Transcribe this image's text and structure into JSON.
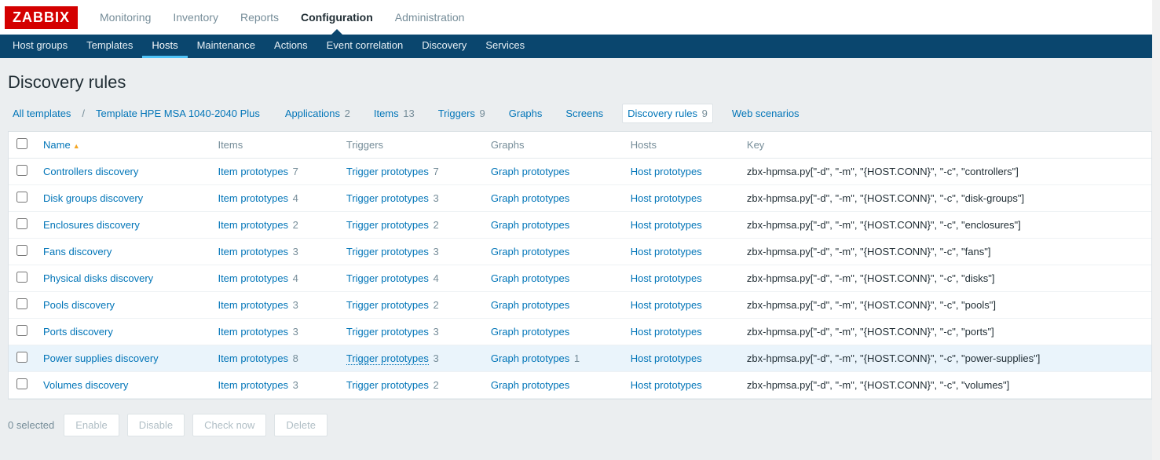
{
  "logo": "ZABBIX",
  "topnav": {
    "items": [
      "Monitoring",
      "Inventory",
      "Reports",
      "Configuration",
      "Administration"
    ],
    "active_index": 3
  },
  "subnav": {
    "items": [
      "Host groups",
      "Templates",
      "Hosts",
      "Maintenance",
      "Actions",
      "Event correlation",
      "Discovery",
      "Services"
    ],
    "active_index": 2
  },
  "page_title": "Discovery rules",
  "crumbs": {
    "all_templates": "All templates",
    "template_name": "Template HPE MSA 1040-2040 Plus",
    "tabs": [
      {
        "label": "Applications",
        "count": 2
      },
      {
        "label": "Items",
        "count": 13
      },
      {
        "label": "Triggers",
        "count": 9
      },
      {
        "label": "Graphs",
        "count": null
      },
      {
        "label": "Screens",
        "count": null
      },
      {
        "label": "Discovery rules",
        "count": 9
      },
      {
        "label": "Web scenarios",
        "count": null
      }
    ],
    "active_tab_index": 5
  },
  "table": {
    "headers": {
      "name": "Name",
      "items": "Items",
      "triggers": "Triggers",
      "graphs": "Graphs",
      "hosts": "Hosts",
      "key": "Key"
    },
    "labels": {
      "item_prototypes": "Item prototypes",
      "trigger_prototypes": "Trigger prototypes",
      "graph_prototypes": "Graph prototypes",
      "host_prototypes": "Host prototypes"
    },
    "rows": [
      {
        "name": "Controllers discovery",
        "items": 7,
        "triggers": 7,
        "graphs": null,
        "key": "zbx-hpmsa.py[\"-d\", \"-m\", \"{HOST.CONN}\", \"-c\", \"controllers\"]"
      },
      {
        "name": "Disk groups discovery",
        "items": 4,
        "triggers": 3,
        "graphs": null,
        "key": "zbx-hpmsa.py[\"-d\", \"-m\", \"{HOST.CONN}\", \"-c\", \"disk-groups\"]"
      },
      {
        "name": "Enclosures discovery",
        "items": 2,
        "triggers": 2,
        "graphs": null,
        "key": "zbx-hpmsa.py[\"-d\", \"-m\", \"{HOST.CONN}\", \"-c\", \"enclosures\"]"
      },
      {
        "name": "Fans discovery",
        "items": 3,
        "triggers": 3,
        "graphs": null,
        "key": "zbx-hpmsa.py[\"-d\", \"-m\", \"{HOST.CONN}\", \"-c\", \"fans\"]"
      },
      {
        "name": "Physical disks discovery",
        "items": 4,
        "triggers": 4,
        "graphs": null,
        "key": "zbx-hpmsa.py[\"-d\", \"-m\", \"{HOST.CONN}\", \"-c\", \"disks\"]"
      },
      {
        "name": "Pools discovery",
        "items": 3,
        "triggers": 2,
        "graphs": null,
        "key": "zbx-hpmsa.py[\"-d\", \"-m\", \"{HOST.CONN}\", \"-c\", \"pools\"]"
      },
      {
        "name": "Ports discovery",
        "items": 3,
        "triggers": 3,
        "graphs": null,
        "key": "zbx-hpmsa.py[\"-d\", \"-m\", \"{HOST.CONN}\", \"-c\", \"ports\"]"
      },
      {
        "name": "Power supplies discovery",
        "items": 8,
        "triggers": 3,
        "triggers_underlined": true,
        "graphs": 1,
        "key": "zbx-hpmsa.py[\"-d\", \"-m\", \"{HOST.CONN}\", \"-c\", \"power-supplies\"]",
        "highlight": true
      },
      {
        "name": "Volumes discovery",
        "items": 3,
        "triggers": 2,
        "graphs": null,
        "key": "zbx-hpmsa.py[\"-d\", \"-m\", \"{HOST.CONN}\", \"-c\", \"volumes\"]"
      }
    ]
  },
  "footer": {
    "selected_count_label": "0 selected",
    "buttons": [
      "Enable",
      "Disable",
      "Check now",
      "Delete"
    ]
  }
}
